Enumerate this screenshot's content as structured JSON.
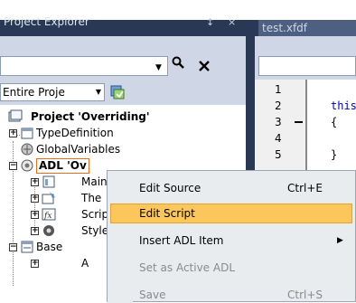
{
  "project_explorer": {
    "title": "Project Explorer",
    "pin_glyph": "↕",
    "close_glyph": "×",
    "search": {
      "value": "",
      "placeholder": ""
    },
    "scope": "Entire Proje",
    "tree": {
      "project": "Project 'Overriding'",
      "type_definition": "TypeDefinition",
      "global_variables": "GlobalVariables",
      "adl_node": "ADL 'Ov",
      "adl_children": [
        "Main",
        "The",
        "Scrip",
        "Style"
      ],
      "base": "Base",
      "base_child": "A"
    }
  },
  "editor": {
    "tab_label": "test.xfdf",
    "line_numbers": [
      "1",
      "2",
      "3",
      "4",
      "5"
    ],
    "code_line2": "this",
    "code_line3": "{",
    "code_line5": "}"
  },
  "context_menu": {
    "items": [
      {
        "label": "Edit Source",
        "shortcut": "Ctrl+E",
        "highlighted": false,
        "disabled": false
      },
      {
        "label": "Edit Script",
        "shortcut": "",
        "highlighted": true,
        "disabled": false
      },
      {
        "label": "Insert ADL Item",
        "shortcut": "",
        "highlighted": false,
        "disabled": false,
        "submenu": true
      },
      {
        "label": "Set as Active ADL",
        "shortcut": "",
        "highlighted": false,
        "disabled": true
      },
      {
        "label": "Save",
        "shortcut": "Ctrl+S",
        "highlighted": false,
        "disabled": true
      }
    ]
  },
  "colors": {
    "titlebar": "#293955",
    "toolbar": "#cfd6e5",
    "menu_highlight": "#fbc65a",
    "selection_border": "#e07020"
  },
  "icons": [
    "search-icon",
    "close-icon",
    "project-icon",
    "type-definition-icon",
    "global-variables-icon",
    "adl-icon",
    "main-icon",
    "theme-icon",
    "script-icon",
    "style-icon",
    "base-icon",
    "toolbar-icon"
  ]
}
